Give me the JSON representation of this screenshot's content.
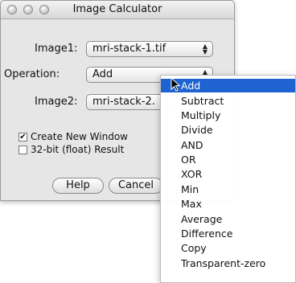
{
  "dialog": {
    "title": "Image Calculator",
    "image1_label": "Image1:",
    "image1_value": "mri-stack-1.tif",
    "operation_label": "Operation:",
    "operation_value": "Add",
    "image2_label": "Image2:",
    "image2_value": "mri-stack-2.",
    "create_window_label": "Create New Window",
    "create_window_checked": true,
    "float_result_label": "32-bit (float) Result",
    "float_result_checked": false,
    "help_label": "Help",
    "cancel_label": "Cancel"
  },
  "menu": {
    "items": [
      "Add",
      "Subtract",
      "Multiply",
      "Divide",
      "AND",
      "OR",
      "XOR",
      "Min",
      "Max",
      "Average",
      "Difference",
      "Copy",
      "Transparent-zero"
    ],
    "selected": "Add"
  },
  "colors": {
    "highlight": "#1f63d1"
  }
}
